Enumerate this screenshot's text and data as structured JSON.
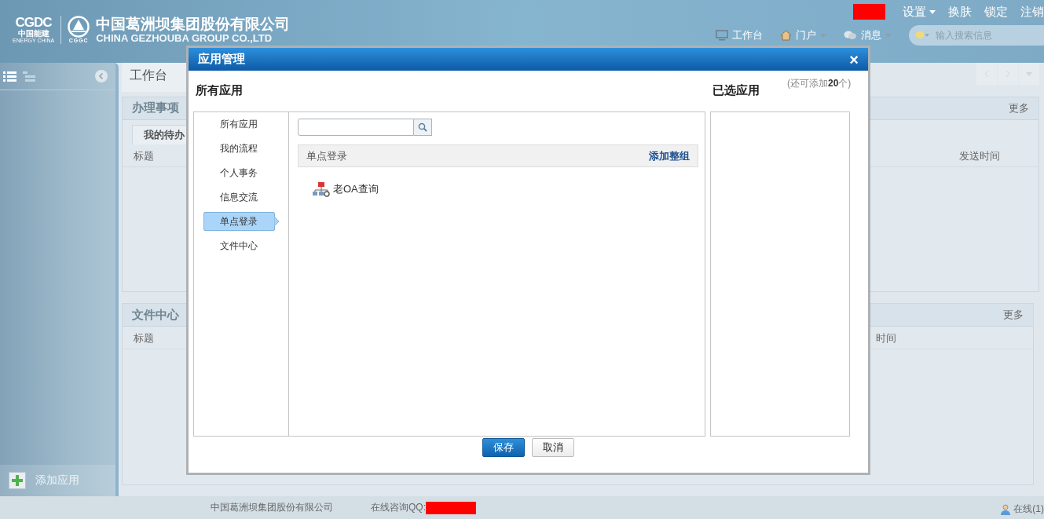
{
  "header": {
    "logo": {
      "mark": "CGDC",
      "mark_cn": "中国能建",
      "mark_en": "ENERGY CHINA",
      "emblem_text": "CGGC",
      "company_cn": "中国葛洲坝集团股份有限公司",
      "company_en": "CHINA GEZHOUBA GROUP CO.,LTD"
    },
    "top_links": [
      {
        "label": "设置",
        "dropdown": true
      },
      {
        "label": "换肤",
        "dropdown": false
      },
      {
        "label": "锁定",
        "dropdown": false
      },
      {
        "label": "注销",
        "dropdown": false
      }
    ],
    "nav": [
      {
        "label": "工作台",
        "kind": "monitor",
        "dropdown": false
      },
      {
        "label": "门户",
        "kind": "home",
        "dropdown": true
      },
      {
        "label": "消息",
        "kind": "chat",
        "dropdown": true
      }
    ],
    "search": {
      "placeholder": "输入搜索信息"
    }
  },
  "sidebar": {
    "add_app": "添加应用"
  },
  "main_tabs": [
    {
      "label": "工作台",
      "selected": true
    }
  ],
  "panels": [
    {
      "title": "办理事项",
      "more": "更多",
      "tabs": [
        {
          "label": "我的待办",
          "selected": true
        }
      ],
      "columns": [
        "标题",
        "发送时间"
      ]
    },
    {
      "title": "文件中心",
      "more": "更多",
      "columns": [
        "标题",
        "时间"
      ]
    }
  ],
  "footer": {
    "company": "中国葛洲坝集团股份有限公司",
    "consult": "在线咨询QQ:",
    "online": "在线(1)"
  },
  "dialog": {
    "title": "应用管理",
    "close": "×",
    "all_title": "所有应用",
    "selected_title": "已选应用",
    "remaining": "(还可添加**20**个)",
    "categories": [
      {
        "label": "所有应用",
        "selected": false
      },
      {
        "label": "我的流程",
        "selected": false
      },
      {
        "label": "个人事务",
        "selected": false
      },
      {
        "label": "信息交流",
        "selected": false
      },
      {
        "label": "单点登录",
        "selected": true
      },
      {
        "label": "文件中心",
        "selected": false
      }
    ],
    "group": {
      "title": "单点登录",
      "add_all": "添加整组",
      "apps": [
        {
          "label": "老OA查询"
        }
      ]
    },
    "buttons": [
      {
        "label": "保存",
        "kind": "primary"
      },
      {
        "label": "取消",
        "kind": "secondary"
      }
    ]
  }
}
